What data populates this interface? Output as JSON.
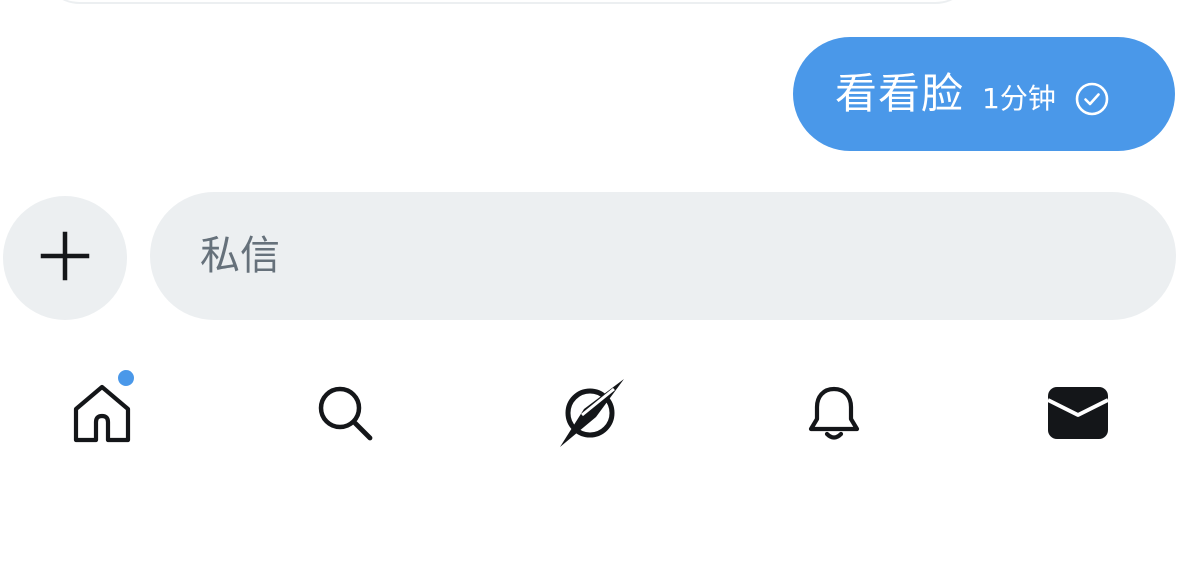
{
  "conversation": {
    "messages": [
      {
        "text": "看看脸",
        "time": "1分钟",
        "status_icon": "check-circle-icon",
        "bubble_color": "#4a98e9"
      }
    ]
  },
  "composer": {
    "add_icon": "plus-icon",
    "placeholder": "私信",
    "value": ""
  },
  "tabbar": {
    "tabs": [
      {
        "icon": "home-icon",
        "has_notification_dot": true
      },
      {
        "icon": "search-icon"
      },
      {
        "icon": "spaces-icon"
      },
      {
        "icon": "bell-icon"
      },
      {
        "icon": "mail-icon",
        "active": true
      }
    ],
    "notification_dot_color": "#4a98e9"
  },
  "colors": {
    "accent": "#4a98e9",
    "input_bg": "#eceff1",
    "placeholder": "#66717b",
    "icon": "#141619"
  }
}
